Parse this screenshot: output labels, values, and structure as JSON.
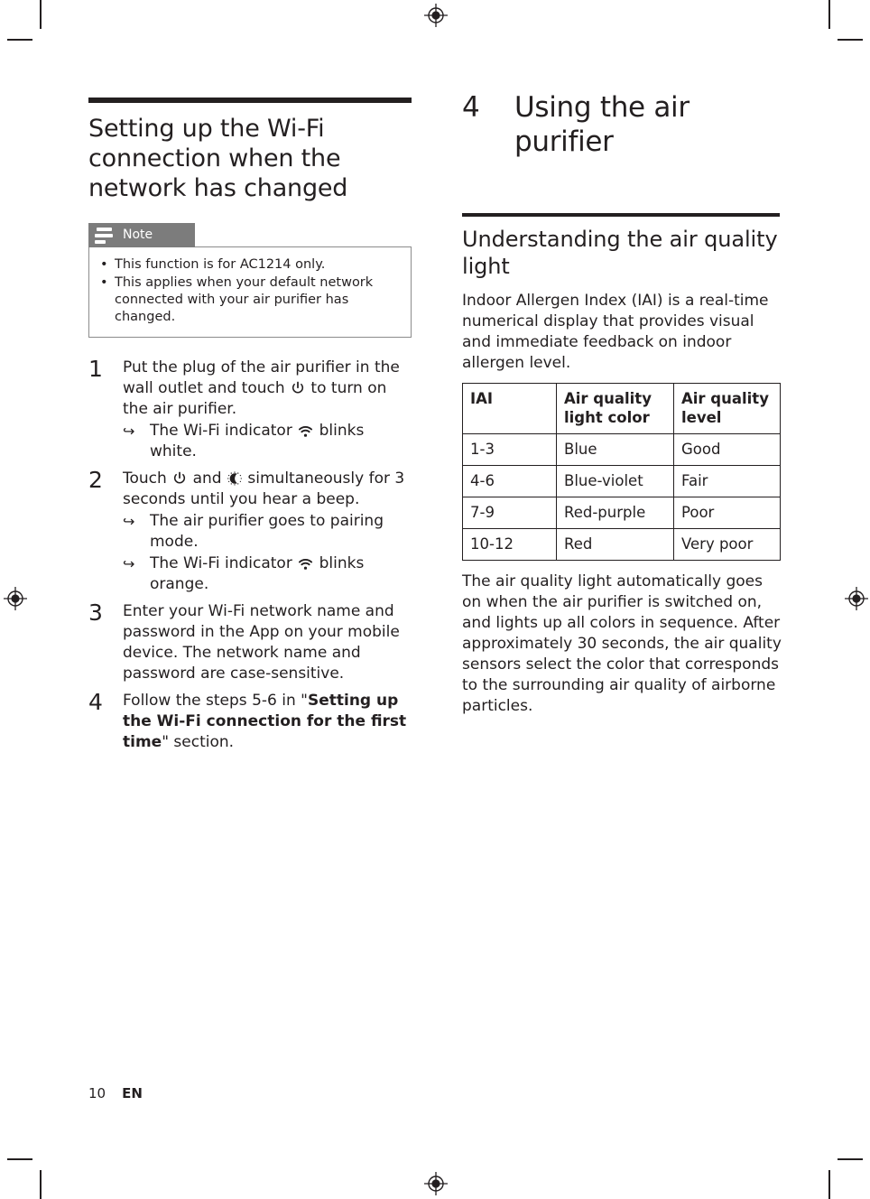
{
  "page": {
    "number": "10",
    "language": "EN"
  },
  "left_column": {
    "section_title": "Setting up the Wi-Fi connection when the network has changed",
    "note": {
      "label": "Note",
      "icon": "note-lines-icon",
      "bullet": "•",
      "items": [
        "This function is for AC1214 only.",
        "This applies when your default network connected with your air purifier has changed."
      ]
    },
    "steps": [
      {
        "number": "1",
        "text_parts": [
          {
            "type": "text",
            "value": "Put the plug of the air purifier in the wall outlet and touch "
          },
          {
            "type": "icon",
            "value": "power-icon"
          },
          {
            "type": "text",
            "value": " to turn on the air purifier."
          }
        ],
        "text_plain": "Put the plug of the air purifier in the wall outlet and touch ⏻ to turn on the air purifier.",
        "substeps": [
          {
            "arrow": "↪",
            "text_plain": "The Wi-Fi indicator ὏6 blinks white.",
            "text_before": "The Wi-Fi indicator ",
            "icon": "wifi-icon",
            "text_after": " blinks white."
          }
        ]
      },
      {
        "number": "2",
        "text_plain": "Touch ⏻ and ☾ simultaneously for 3 seconds until you hear a beep.",
        "text_before": "Touch ",
        "icon_1": "power-icon",
        "text_middle": " and ",
        "icon_2": "night-mode-moon-icon",
        "text_after": " simultaneously for 3 seconds until you hear a beep.",
        "substeps": [
          {
            "arrow": "↪",
            "text_plain": "The air purifier goes to pairing mode.",
            "text_before": "The air purifier goes to pairing mode.",
            "icon": null,
            "text_after": ""
          },
          {
            "arrow": "↪",
            "text_plain": "The Wi-Fi indicator ὏6 blinks orange.",
            "text_before": "The Wi-Fi indicator ",
            "icon": "wifi-icon",
            "text_after": " blinks orange."
          }
        ]
      },
      {
        "number": "3",
        "text_plain": "Enter your Wi-Fi network name and password in the App on your mobile device. The network name and password are case-sensitive.",
        "substeps": []
      },
      {
        "number": "4",
        "text_plain": "Follow the steps 5-6 in \"Setting up the Wi-Fi connection for the first time\" section.",
        "prefix": "Follow the steps 5-6 in \"",
        "bold": "Setting up the Wi-Fi connection for the first time",
        "suffix": "\" section.",
        "substeps": []
      }
    ]
  },
  "right_column": {
    "chapter_number": "4",
    "chapter_title": "Using the air purifier",
    "section_title": "Understanding the air quality light",
    "intro_paragraph": "Indoor Allergen Index (IAI) is a real-time numerical display that provides visual and immediate feedback on indoor allergen level.",
    "table": {
      "headers": [
        "IAI",
        "Air quality light color",
        "Air quality level"
      ],
      "rows": [
        [
          "1-3",
          "Blue",
          "Good"
        ],
        [
          "4-6",
          "Blue-violet",
          "Fair"
        ],
        [
          "7-9",
          "Red-purple",
          "Poor"
        ],
        [
          "10-12",
          "Red",
          "Very poor"
        ]
      ]
    },
    "closing_paragraph": "The air quality light automatically goes on when the air purifier is switched on, and lights up all colors in sequence. After approximately 30 seconds, the air quality sensors select the color that corresponds to the surrounding air quality of airborne particles."
  },
  "colors": {
    "text": "#231f20",
    "note_tab_bg": "#7c7c7c",
    "note_border": "#8c8c8c",
    "rule": "#231f20"
  }
}
